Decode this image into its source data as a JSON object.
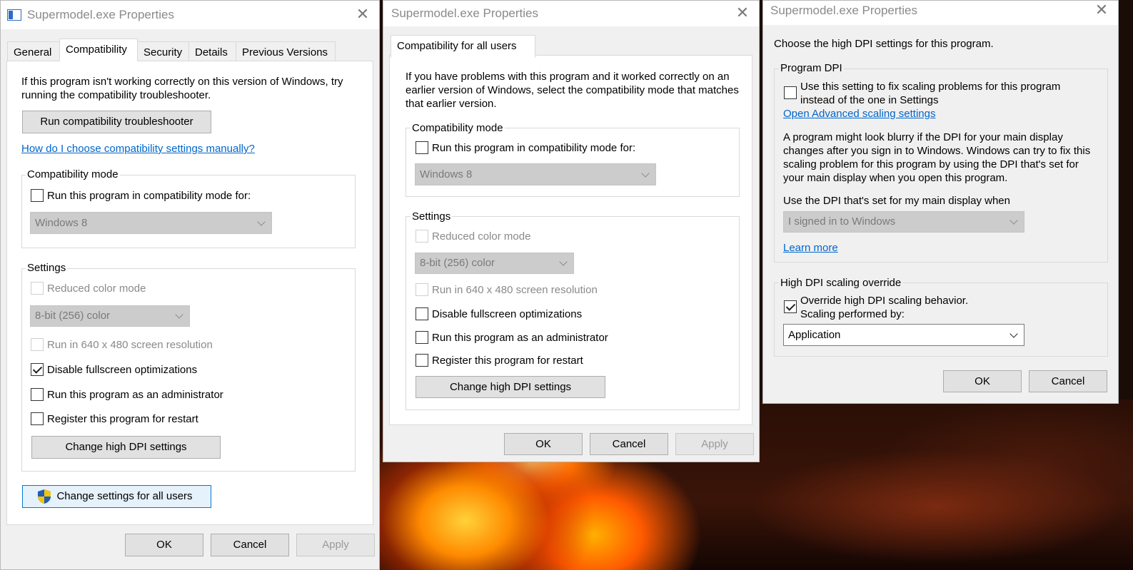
{
  "window1": {
    "title": "Supermodel.exe Properties",
    "tabs": [
      "General",
      "Compatibility",
      "Security",
      "Details",
      "Previous Versions"
    ],
    "intro": "If this program isn't working correctly on this version of Windows, try running the compatibility troubleshooter.",
    "troubleshooter_button": "Run compatibility troubleshooter",
    "help_link": "How do I choose compatibility settings manually?",
    "compat_group": "Compatibility mode",
    "compat_checkbox": "Run this program in compatibility mode for:",
    "compat_select": "Windows 8",
    "settings_group": "Settings",
    "reduced_color": "Reduced color mode",
    "color_select": "8-bit (256) color",
    "res_640": "Run in 640 x 480 screen resolution",
    "disable_fullscreen": "Disable fullscreen optimizations",
    "run_admin": "Run this program as an administrator",
    "register_restart": "Register this program for restart",
    "dpi_button": "Change high DPI settings",
    "all_users_button": "Change settings for all users",
    "ok": "OK",
    "cancel": "Cancel",
    "apply": "Apply"
  },
  "window2": {
    "title": "Supermodel.exe Properties",
    "tab": "Compatibility for all users",
    "intro": "If you have problems with this program and it worked correctly on an earlier version of Windows, select the compatibility mode that matches that earlier version.",
    "compat_group": "Compatibility mode",
    "compat_checkbox": "Run this program in compatibility mode for:",
    "compat_select": "Windows 8",
    "settings_group": "Settings",
    "reduced_color": "Reduced color mode",
    "color_select": "8-bit (256) color",
    "res_640": "Run in 640 x 480 screen resolution",
    "disable_fullscreen": "Disable fullscreen optimizations",
    "run_admin": "Run this program as an administrator",
    "register_restart": "Register this program for restart",
    "dpi_button": "Change high DPI settings",
    "ok": "OK",
    "cancel": "Cancel",
    "apply": "Apply"
  },
  "window3": {
    "title": "Supermodel.exe Properties",
    "heading": "Choose the high DPI settings for this program.",
    "program_dpi_group": "Program DPI",
    "use_setting_line1": "Use this setting to fix scaling problems for this program",
    "use_setting_line2": "instead of the one in Settings",
    "advanced_link": "Open Advanced scaling settings",
    "blurry_text": "A program might look blurry if the DPI for your main display changes after you sign in to Windows. Windows can try to fix this scaling problem for this program by using the DPI that's set for your main display when you open this program.",
    "use_dpi_label": "Use the DPI that's set for my main display when",
    "signin_select": "I signed in to Windows",
    "learn_more": "Learn more",
    "override_group": "High DPI scaling override",
    "override_line1": "Override high DPI scaling behavior.",
    "override_line2": "Scaling performed by:",
    "scaling_select": "Application",
    "ok": "OK",
    "cancel": "Cancel"
  }
}
